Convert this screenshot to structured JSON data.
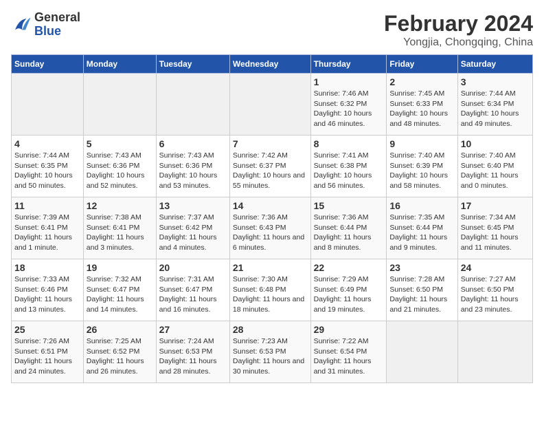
{
  "header": {
    "logo_general": "General",
    "logo_blue": "Blue",
    "title": "February 2024",
    "subtitle": "Yongjia, Chongqing, China"
  },
  "weekdays": [
    "Sunday",
    "Monday",
    "Tuesday",
    "Wednesday",
    "Thursday",
    "Friday",
    "Saturday"
  ],
  "weeks": [
    [
      {
        "day": "",
        "sunrise": "",
        "sunset": "",
        "daylight": "",
        "empty": true
      },
      {
        "day": "",
        "sunrise": "",
        "sunset": "",
        "daylight": "",
        "empty": true
      },
      {
        "day": "",
        "sunrise": "",
        "sunset": "",
        "daylight": "",
        "empty": true
      },
      {
        "day": "",
        "sunrise": "",
        "sunset": "",
        "daylight": "",
        "empty": true
      },
      {
        "day": "1",
        "sunrise": "Sunrise: 7:46 AM",
        "sunset": "Sunset: 6:32 PM",
        "daylight": "Daylight: 10 hours and 46 minutes."
      },
      {
        "day": "2",
        "sunrise": "Sunrise: 7:45 AM",
        "sunset": "Sunset: 6:33 PM",
        "daylight": "Daylight: 10 hours and 48 minutes."
      },
      {
        "day": "3",
        "sunrise": "Sunrise: 7:44 AM",
        "sunset": "Sunset: 6:34 PM",
        "daylight": "Daylight: 10 hours and 49 minutes."
      }
    ],
    [
      {
        "day": "4",
        "sunrise": "Sunrise: 7:44 AM",
        "sunset": "Sunset: 6:35 PM",
        "daylight": "Daylight: 10 hours and 50 minutes."
      },
      {
        "day": "5",
        "sunrise": "Sunrise: 7:43 AM",
        "sunset": "Sunset: 6:36 PM",
        "daylight": "Daylight: 10 hours and 52 minutes."
      },
      {
        "day": "6",
        "sunrise": "Sunrise: 7:43 AM",
        "sunset": "Sunset: 6:36 PM",
        "daylight": "Daylight: 10 hours and 53 minutes."
      },
      {
        "day": "7",
        "sunrise": "Sunrise: 7:42 AM",
        "sunset": "Sunset: 6:37 PM",
        "daylight": "Daylight: 10 hours and 55 minutes."
      },
      {
        "day": "8",
        "sunrise": "Sunrise: 7:41 AM",
        "sunset": "Sunset: 6:38 PM",
        "daylight": "Daylight: 10 hours and 56 minutes."
      },
      {
        "day": "9",
        "sunrise": "Sunrise: 7:40 AM",
        "sunset": "Sunset: 6:39 PM",
        "daylight": "Daylight: 10 hours and 58 minutes."
      },
      {
        "day": "10",
        "sunrise": "Sunrise: 7:40 AM",
        "sunset": "Sunset: 6:40 PM",
        "daylight": "Daylight: 11 hours and 0 minutes."
      }
    ],
    [
      {
        "day": "11",
        "sunrise": "Sunrise: 7:39 AM",
        "sunset": "Sunset: 6:41 PM",
        "daylight": "Daylight: 11 hours and 1 minute."
      },
      {
        "day": "12",
        "sunrise": "Sunrise: 7:38 AM",
        "sunset": "Sunset: 6:41 PM",
        "daylight": "Daylight: 11 hours and 3 minutes."
      },
      {
        "day": "13",
        "sunrise": "Sunrise: 7:37 AM",
        "sunset": "Sunset: 6:42 PM",
        "daylight": "Daylight: 11 hours and 4 minutes."
      },
      {
        "day": "14",
        "sunrise": "Sunrise: 7:36 AM",
        "sunset": "Sunset: 6:43 PM",
        "daylight": "Daylight: 11 hours and 6 minutes."
      },
      {
        "day": "15",
        "sunrise": "Sunrise: 7:36 AM",
        "sunset": "Sunset: 6:44 PM",
        "daylight": "Daylight: 11 hours and 8 minutes."
      },
      {
        "day": "16",
        "sunrise": "Sunrise: 7:35 AM",
        "sunset": "Sunset: 6:44 PM",
        "daylight": "Daylight: 11 hours and 9 minutes."
      },
      {
        "day": "17",
        "sunrise": "Sunrise: 7:34 AM",
        "sunset": "Sunset: 6:45 PM",
        "daylight": "Daylight: 11 hours and 11 minutes."
      }
    ],
    [
      {
        "day": "18",
        "sunrise": "Sunrise: 7:33 AM",
        "sunset": "Sunset: 6:46 PM",
        "daylight": "Daylight: 11 hours and 13 minutes."
      },
      {
        "day": "19",
        "sunrise": "Sunrise: 7:32 AM",
        "sunset": "Sunset: 6:47 PM",
        "daylight": "Daylight: 11 hours and 14 minutes."
      },
      {
        "day": "20",
        "sunrise": "Sunrise: 7:31 AM",
        "sunset": "Sunset: 6:47 PM",
        "daylight": "Daylight: 11 hours and 16 minutes."
      },
      {
        "day": "21",
        "sunrise": "Sunrise: 7:30 AM",
        "sunset": "Sunset: 6:48 PM",
        "daylight": "Daylight: 11 hours and 18 minutes."
      },
      {
        "day": "22",
        "sunrise": "Sunrise: 7:29 AM",
        "sunset": "Sunset: 6:49 PM",
        "daylight": "Daylight: 11 hours and 19 minutes."
      },
      {
        "day": "23",
        "sunrise": "Sunrise: 7:28 AM",
        "sunset": "Sunset: 6:50 PM",
        "daylight": "Daylight: 11 hours and 21 minutes."
      },
      {
        "day": "24",
        "sunrise": "Sunrise: 7:27 AM",
        "sunset": "Sunset: 6:50 PM",
        "daylight": "Daylight: 11 hours and 23 minutes."
      }
    ],
    [
      {
        "day": "25",
        "sunrise": "Sunrise: 7:26 AM",
        "sunset": "Sunset: 6:51 PM",
        "daylight": "Daylight: 11 hours and 24 minutes."
      },
      {
        "day": "26",
        "sunrise": "Sunrise: 7:25 AM",
        "sunset": "Sunset: 6:52 PM",
        "daylight": "Daylight: 11 hours and 26 minutes."
      },
      {
        "day": "27",
        "sunrise": "Sunrise: 7:24 AM",
        "sunset": "Sunset: 6:53 PM",
        "daylight": "Daylight: 11 hours and 28 minutes."
      },
      {
        "day": "28",
        "sunrise": "Sunrise: 7:23 AM",
        "sunset": "Sunset: 6:53 PM",
        "daylight": "Daylight: 11 hours and 30 minutes."
      },
      {
        "day": "29",
        "sunrise": "Sunrise: 7:22 AM",
        "sunset": "Sunset: 6:54 PM",
        "daylight": "Daylight: 11 hours and 31 minutes."
      },
      {
        "day": "",
        "sunrise": "",
        "sunset": "",
        "daylight": "",
        "empty": true
      },
      {
        "day": "",
        "sunrise": "",
        "sunset": "",
        "daylight": "",
        "empty": true
      }
    ]
  ]
}
